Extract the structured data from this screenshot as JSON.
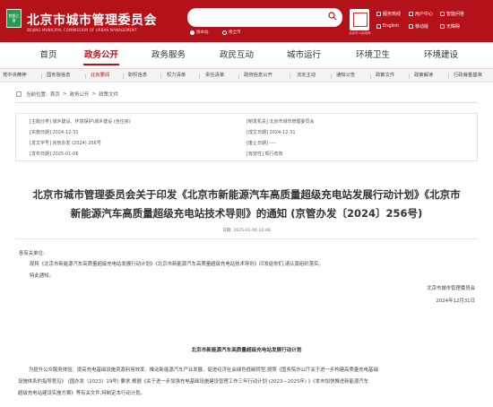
{
  "header": {
    "logo_text": "首都之窗",
    "site_name": "北京市城市管理委员会",
    "site_sub": "BEIJING MUNICIPAL COMMISSION OF URBAN MANAGEMENT",
    "search_scope": [
      "搜本站",
      "搜全市"
    ],
    "seal_caption": "北京市人民政府",
    "tools": [
      "服务热线",
      "用户中心",
      "智能问答",
      "English",
      "移动版",
      "无障碍"
    ]
  },
  "main_nav": [
    "首页",
    "政务公开",
    "政务服务",
    "政民互动",
    "城市运行",
    "环境卫生",
    "环境建设"
  ],
  "main_nav_active": "政务公开",
  "sub_nav": [
    "党中央精神",
    "国务院信息",
    "北京要闻",
    "职权信息",
    "权力清单",
    "责任清单",
    "政府信息公开",
    "法定主动",
    "通知公告",
    "政策文件",
    "政策解读",
    "行政裁量基准"
  ],
  "sub_nav_active": "北京要闻",
  "breadcrumb": {
    "label": "当前位置:",
    "items": [
      "首页",
      "政务公开",
      "政策文件"
    ],
    "sep": ">"
  },
  "meta": {
    "subject": "[主题分类] 城乡建设、环境保护\\城乡建设 (含住房)",
    "issuer": "[制发机关] 北京市城市管理委员会",
    "effective_date": "[实施日期] 2024-12-31",
    "written_date": "[成文日期] 2024-12-31",
    "doc_no": "[发文字号] 京管办发 (2024) 256号",
    "expire_date": "[废止日期] ----",
    "publish_date": "[发布日期] 2025-01-06",
    "validity": "[有效性] 现行有效"
  },
  "document": {
    "title_line1": "北京市城市管理委员会关于印发《北京市新能源汽车高质量超级充电站发展行动计划》《北京市",
    "title_line2": "新能源汽车高质量超级充电站技术导则》的通知 (京管办发〔2024〕256号)",
    "date": "日期: 2025-01-06 14:48",
    "salutation": "各有关单位:",
    "para1": "现将《北京市新能源汽车高质量超级充电站发展行动计划》《北京市新能源汽车高质量超级充电站技术导则》印发给你们,请认真组织落实。",
    "para2": "特此通知。",
    "signer": "北京市城市管理委员会",
    "sign_date": "2024年12月31日",
    "section_title": "北京市新能源汽车高质量超级充电站发展行动计划",
    "body_line1": "为提升公众服务体验、提高充电基础设施资源利用效率、推动新能源汽车产业发展、促进经济社会绿色低碳转型,按照《国务院办公厅关于进一步构建高质量充电基础",
    "body_line2": "设施体系的指导意见》 (国办发〔2023〕19号) 要求,根据《关于进一步加强充电基础设施建设管理工作三年行动计划 (2023—2025年) 》《本市加快推进新能源汽车",
    "body_line3": "超级充电站建设实施方案》等有关文件,特制定本行动计划。"
  },
  "colors": {
    "brand_red": "#b4121a",
    "logo_green": "#1f9e4f"
  }
}
